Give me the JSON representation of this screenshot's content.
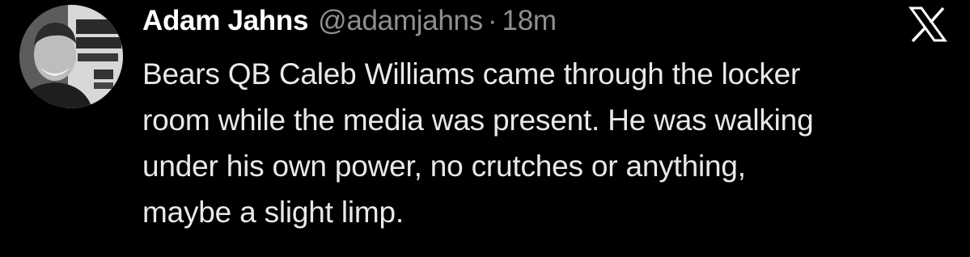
{
  "tweet": {
    "author": {
      "display_name": "Adam Jahns",
      "handle": "@adamjahns",
      "avatar_icon": "profile-photo-icon"
    },
    "separator": "·",
    "timestamp": "18m",
    "brand_icon": "x-logo-icon",
    "text_lines": [
      "Bears QB Caleb Williams came through the locker",
      "room while the media was present. He was walking",
      "under his own power, no crutches or anything,",
      "maybe a slight limp."
    ]
  },
  "colors": {
    "background": "#000000",
    "primary_text": "#e7e9ea",
    "secondary_text": "#8f8f8f"
  }
}
